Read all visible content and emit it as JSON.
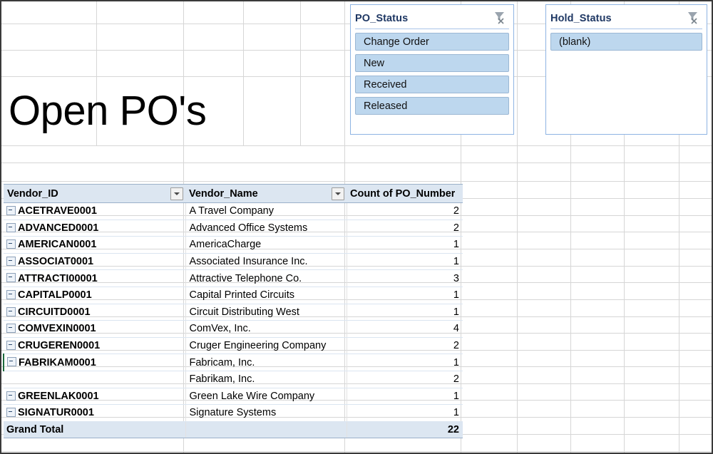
{
  "sheet": {
    "title": "Open PO's"
  },
  "slicers": [
    {
      "name": "po-status",
      "title": "PO_Status",
      "clear_filter_icon": "clear-filter-icon",
      "items": [
        "Change Order",
        "New",
        "Received",
        "Released"
      ]
    },
    {
      "name": "hold-status",
      "title": "Hold_Status",
      "clear_filter_icon": "clear-filter-icon",
      "items": [
        "(blank)"
      ]
    }
  ],
  "pivot": {
    "headers": [
      "Vendor_ID",
      "Vendor_Name",
      "Count of PO_Number"
    ],
    "filter_icon": "chevron-down-icon",
    "rows": [
      {
        "id": "ACETRAVE0001",
        "name": "A Travel Company",
        "count": "2",
        "expander": true
      },
      {
        "id": "ADVANCED0001",
        "name": "Advanced Office Systems",
        "count": "2",
        "expander": true
      },
      {
        "id": "AMERICAN0001",
        "name": "AmericaCharge",
        "count": "1",
        "expander": true
      },
      {
        "id": "ASSOCIAT0001",
        "name": "Associated Insurance Inc.",
        "count": "1",
        "expander": true
      },
      {
        "id": "ATTRACTI00001",
        "name": "Attractive Telephone Co.",
        "count": "3",
        "expander": true
      },
      {
        "id": "CAPITALP0001",
        "name": "Capital Printed Circuits",
        "count": "1",
        "expander": true
      },
      {
        "id": "CIRCUITD0001",
        "name": "Circuit Distributing West",
        "count": "1",
        "expander": true
      },
      {
        "id": "COMVEXIN0001",
        "name": "ComVex, Inc.",
        "count": "4",
        "expander": true
      },
      {
        "id": "CRUGEREN0001",
        "name": "Cruger Engineering Company",
        "count": "2",
        "expander": true
      },
      {
        "id": "FABRIKAM0001",
        "name": "Fabricam, Inc.",
        "count": "1",
        "expander": true,
        "active": true
      },
      {
        "id": "",
        "name": "Fabrikam, Inc.",
        "count": "2",
        "expander": false
      },
      {
        "id": "GREENLAK0001",
        "name": "Green Lake Wire Company",
        "count": "1",
        "expander": true
      },
      {
        "id": "SIGNATUR0001",
        "name": "Signature Systems",
        "count": "1",
        "expander": true
      }
    ],
    "grand_total": {
      "label": "Grand Total",
      "count": "22"
    }
  },
  "colors": {
    "slicer_item_fill": "#bdd7ee",
    "header_fill": "#dce6f1",
    "slicer_border": "#8eb4e3",
    "slicer_title": "#1f3864",
    "gridline": "#d6d6d6"
  }
}
